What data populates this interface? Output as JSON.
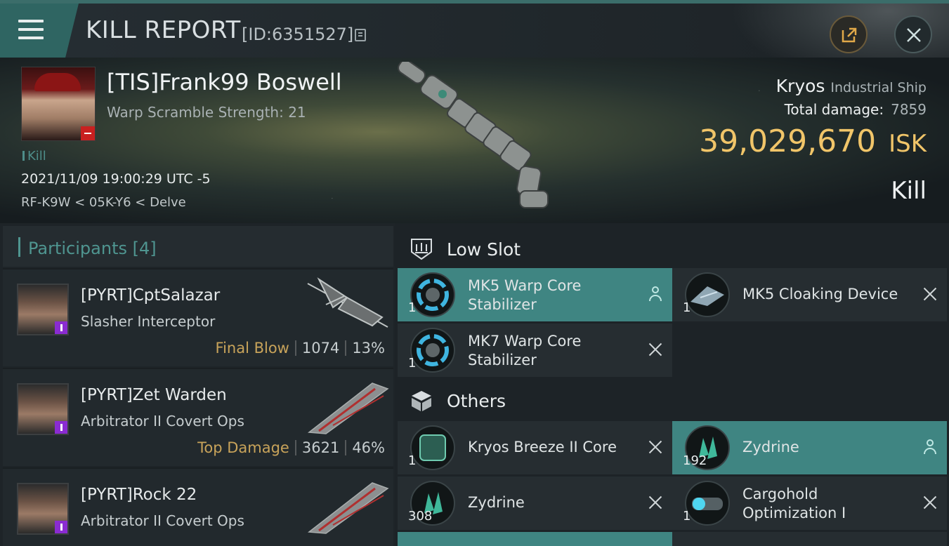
{
  "header": {
    "title": "KILL REPORT",
    "report_id": "[ID:6351527]",
    "copy_icon": "copy-icon",
    "share_icon": "external-link-icon",
    "close_icon": "close-icon",
    "menu_icon": "hamburger-menu-icon"
  },
  "victim": {
    "name": "[TIS]Frank99 Boswell",
    "warp_scramble": "Warp Scramble Strength: 21",
    "tag": "Kill",
    "datetime": "2021/11/09 19:00:29 UTC -5",
    "location": "RF-K9W < 05K-Y6 < Delve",
    "ship_name": "Kryos",
    "ship_class": "Industrial Ship",
    "total_damage_label": "Total damage:",
    "total_damage": "7859",
    "isk_value": "39,029,670",
    "isk_unit": "ISK",
    "result": "Kill"
  },
  "participants": {
    "label": "Participants [4]",
    "items": [
      {
        "name": "[PYRT]CptSalazar",
        "ship": "Slasher Interceptor",
        "tag": "Final Blow",
        "damage": "1074",
        "percent": "13%"
      },
      {
        "name": "[PYRT]Zet Warden",
        "ship": "Arbitrator II Covert Ops",
        "tag": "Top Damage",
        "damage": "3621",
        "percent": "46%"
      },
      {
        "name": "[PYRT]Rock 22",
        "ship": "Arbitrator II Covert Ops",
        "tag": "",
        "damage": "",
        "percent": ""
      }
    ]
  },
  "low_slot": {
    "label": "Low Slot",
    "items": [
      {
        "name": "MK5 Warp Core Stabilizer",
        "qty": "1",
        "highlighted": true
      },
      {
        "name": "MK5 Cloaking Device",
        "qty": "1",
        "highlighted": false
      },
      {
        "name": "MK7 Warp Core Stabilizer",
        "qty": "1",
        "highlighted": false
      }
    ]
  },
  "others": {
    "label": "Others",
    "items": [
      {
        "name": "Kryos Breeze II Core",
        "qty": "1",
        "highlighted": false
      },
      {
        "name": "Zydrine",
        "qty": "192",
        "highlighted": true
      },
      {
        "name": "Zydrine",
        "qty": "308",
        "highlighted": false
      },
      {
        "name": "Cargohold Optimization I",
        "qty": "1",
        "highlighted": false
      }
    ]
  },
  "colors": {
    "accent": "#3f8582",
    "isk": "#f1c569",
    "final_blow": "#c8a35a",
    "header_tab": "#2f6562"
  }
}
